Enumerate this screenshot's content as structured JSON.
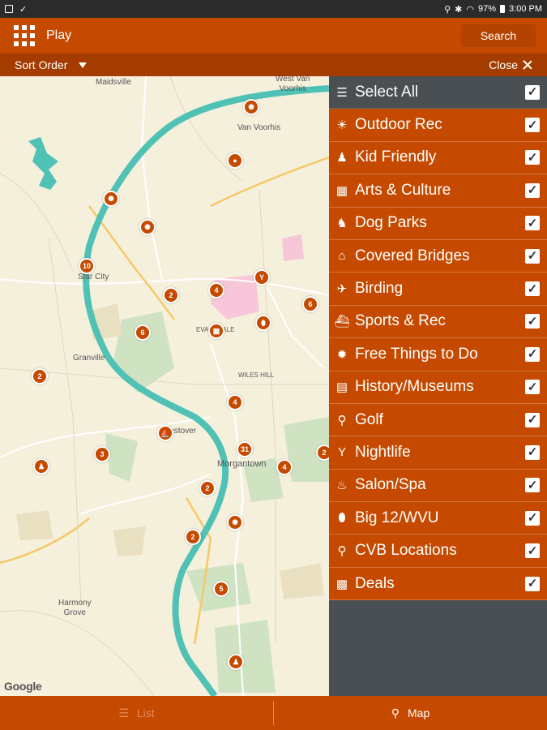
{
  "status_bar": {
    "battery": "97%",
    "time": "3:00 PM"
  },
  "app_bar": {
    "title": "Play",
    "search_label": "Search"
  },
  "sort_bar": {
    "sort_label": "Sort Order",
    "close_label": "Close"
  },
  "map": {
    "labels": {
      "maidsville": "Maidsville",
      "west_van_voorhis": "West Van\nVoorhis",
      "van_voorhis": "Van Voorhis",
      "star_city": "Star City",
      "granville": "Granville",
      "evansdale": "EVANSDALE",
      "wiles_hill": "WILES HILL",
      "westover": "Westover",
      "morgantown": "Morgantown",
      "harmony_grove": "Harmony\nGrove"
    },
    "markers": {
      "m10": "10",
      "m2a": "2",
      "m4a": "4",
      "m6a": "6",
      "m6b": "6",
      "m2b": "2",
      "m4b": "4",
      "m3": "3",
      "m31": "31",
      "m4c": "4",
      "m2c": "2",
      "m2d": "2",
      "m2e": "2",
      "m5": "5"
    },
    "attribution": "Google"
  },
  "categories": {
    "select_all": {
      "label": "Select All",
      "checked": true
    },
    "items": [
      {
        "label": "Outdoor Rec",
        "icon": "sun-icon",
        "checked": true
      },
      {
        "label": "Kid Friendly",
        "icon": "kid-icon",
        "checked": true
      },
      {
        "label": "Arts & Culture",
        "icon": "theater-icon",
        "checked": true
      },
      {
        "label": "Dog Parks",
        "icon": "dog-icon",
        "checked": true
      },
      {
        "label": "Covered Bridges",
        "icon": "bridge-icon",
        "checked": true
      },
      {
        "label": "Birding",
        "icon": "bird-icon",
        "checked": true
      },
      {
        "label": "Sports & Rec",
        "icon": "boat-icon",
        "checked": true
      },
      {
        "label": "Free Things to Do",
        "icon": "free-icon",
        "checked": true
      },
      {
        "label": "History/Museums",
        "icon": "book-icon",
        "checked": true
      },
      {
        "label": "Golf",
        "icon": "golf-icon",
        "checked": true
      },
      {
        "label": "Nightlife",
        "icon": "cocktail-icon",
        "checked": true
      },
      {
        "label": "Salon/Spa",
        "icon": "spa-icon",
        "checked": true
      },
      {
        "label": "Big 12/WVU",
        "icon": "football-icon",
        "checked": true
      },
      {
        "label": "CVB Locations",
        "icon": "location-pin-icon",
        "checked": true
      },
      {
        "label": "Deals",
        "icon": "deals-icon",
        "checked": true
      }
    ]
  },
  "bottom_tabs": {
    "list_label": "List",
    "map_label": "Map"
  },
  "colors": {
    "primary": "#c54a00",
    "panel_bg": "#4a4f53",
    "river": "#4fc1b5",
    "map_bg": "#f5f0dc"
  }
}
